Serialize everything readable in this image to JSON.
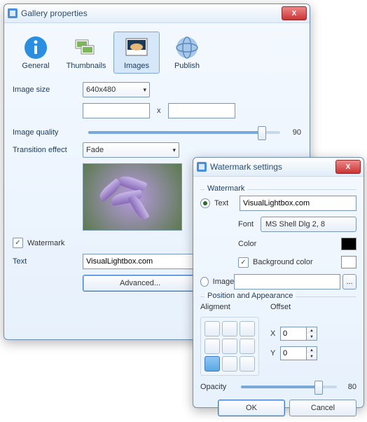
{
  "main": {
    "title": "Gallery properties",
    "tabs": [
      "General",
      "Thumbnails",
      "Images",
      "Publish"
    ],
    "imageSizeLabel": "Image size",
    "imageSize": "640x480",
    "dimW": "",
    "dimH": "",
    "dimSep": "x",
    "qualityLabel": "Image quality",
    "quality": "90",
    "transLabel": "Transition effect",
    "trans": "Fade",
    "wmCheck": "Watermark",
    "wmTextLabel": "Text",
    "wmText": "VisualLightbox.com",
    "adv": "Advanced..."
  },
  "wm": {
    "title": "Watermark settings",
    "groupLabel": "Watermark",
    "textLabel": "Text",
    "text": "VisualLightbox.com",
    "fontLabel": "Font",
    "font": "MS Shell Dlg 2, 8",
    "colorLabel": "Color",
    "color": "#000000",
    "bgLabel": "Background color",
    "bgColor": "#ffffff",
    "imageLabel": "Image",
    "imagePath": "",
    "browse": "...",
    "posLabel": "Position and Appearance",
    "alignLabel": "Aligment",
    "offsetLabel": "Offset",
    "xLabel": "X",
    "x": "0",
    "yLabel": "Y",
    "y": "0",
    "opacityLabel": "Opacity",
    "opacity": "80",
    "ok": "OK",
    "cancel": "Cancel"
  }
}
